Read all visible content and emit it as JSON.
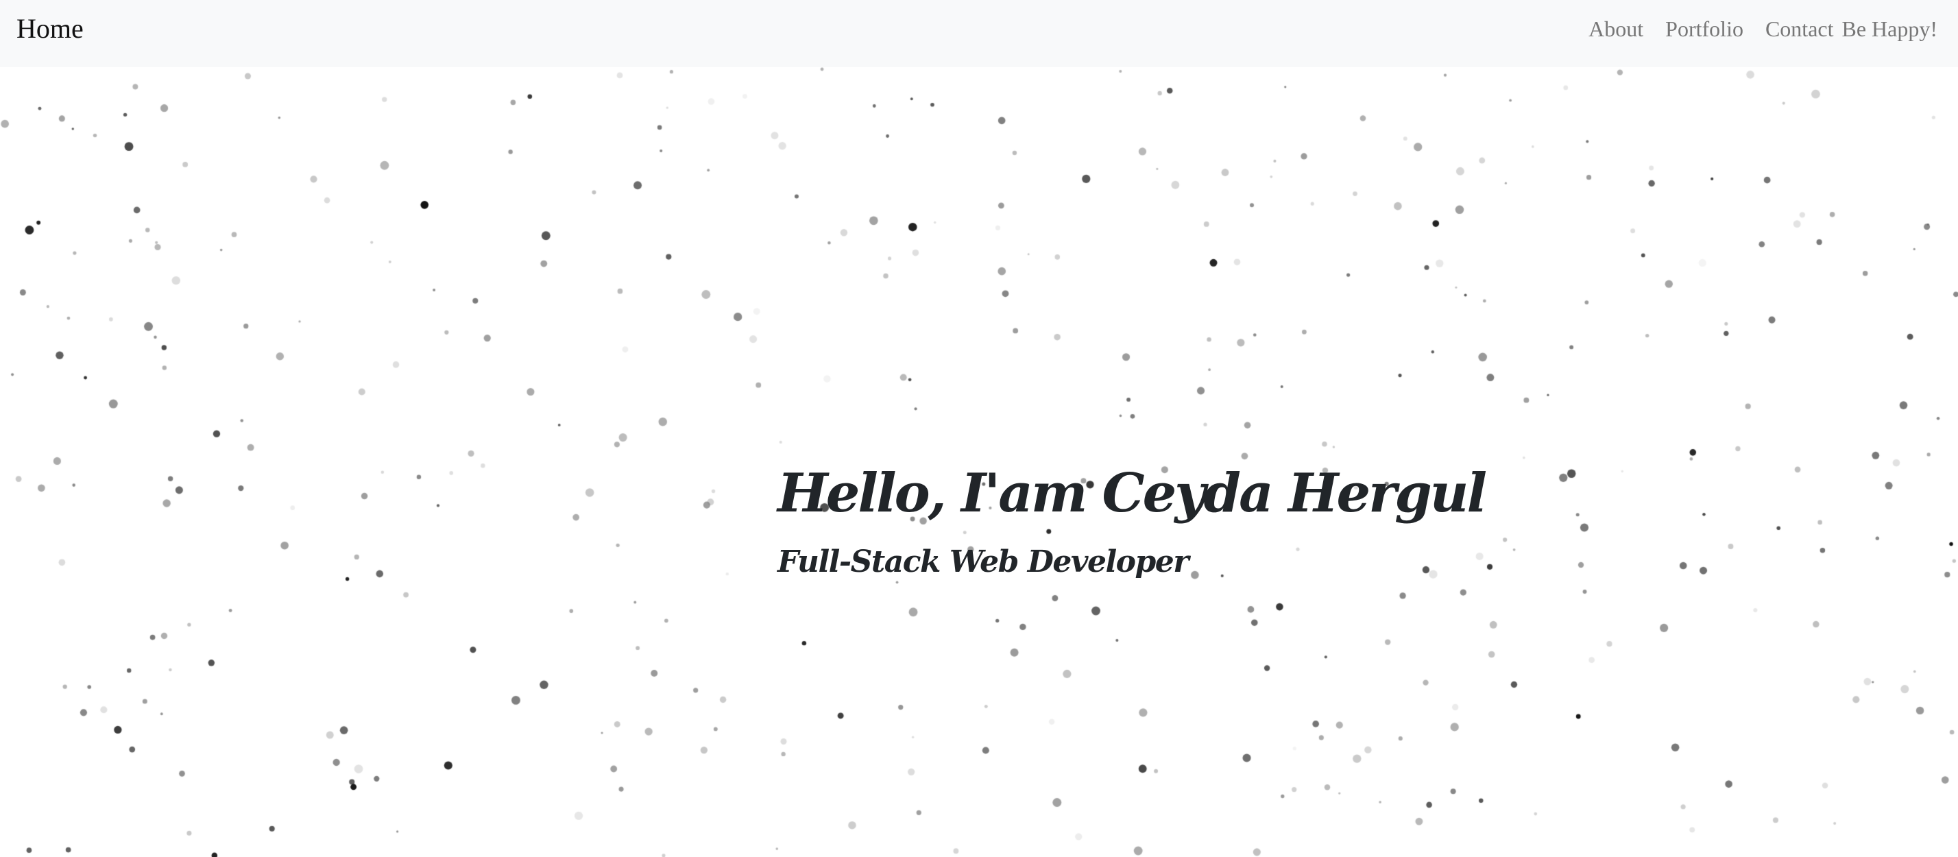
{
  "navbar": {
    "brand": "Home",
    "links": [
      {
        "label": "About"
      },
      {
        "label": "Portfolio"
      },
      {
        "label": "Contact"
      }
    ],
    "tagline": "Be Happy!"
  },
  "hero": {
    "title": "Hello, I'am Ceyda Hergul",
    "subtitle": "Full-Stack Web Developer"
  },
  "colors": {
    "navbar_bg": "#f8f9fa",
    "nav_link": "#777777",
    "hero_text": "#212529",
    "page_bg": "#ffffff"
  }
}
